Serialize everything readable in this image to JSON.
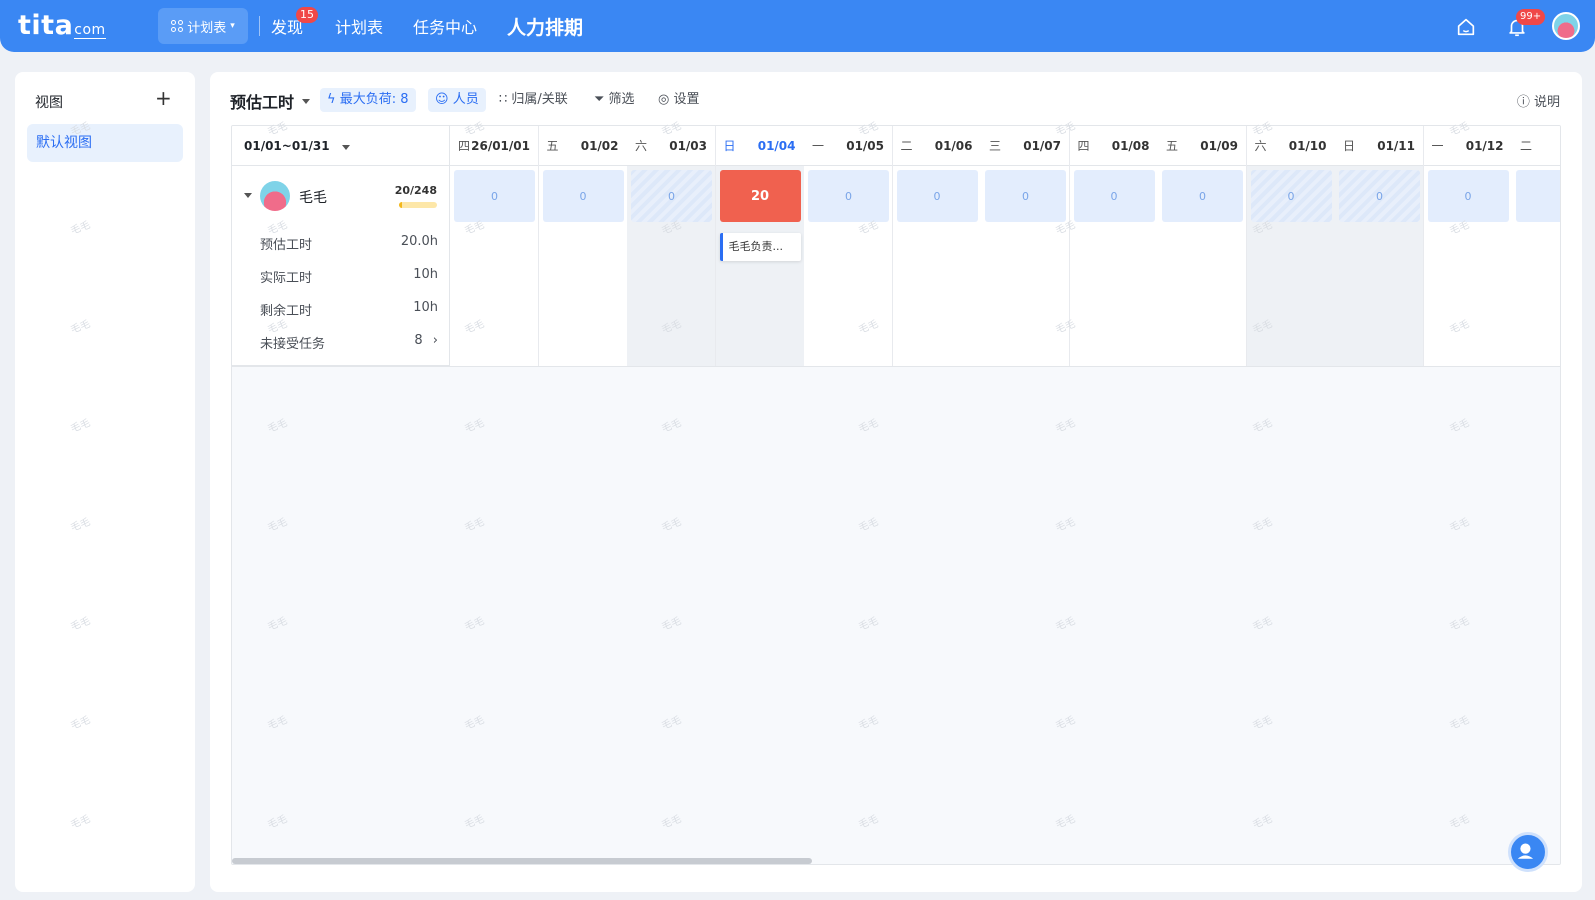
{
  "topbar": {
    "logo_text": "tita",
    "logo_domain": "com",
    "plan_switch_label": "计划表",
    "nav": [
      {
        "label": "发现",
        "badge": "15"
      },
      {
        "label": "计划表"
      },
      {
        "label": "任务中心"
      },
      {
        "label": "人力排期"
      }
    ],
    "bell_badge": "99+",
    "icons": [
      "home-icon",
      "bell-icon",
      "avatar"
    ]
  },
  "sidebar": {
    "title": "视图",
    "add_label": "+",
    "items": [
      {
        "label": "默认视图",
        "selected": true
      }
    ]
  },
  "toolbar": {
    "title": "预估工时",
    "max_load": "最大负荷: 8",
    "people": "人员",
    "relation": "归属/关联",
    "filter": "筛选",
    "settings": "设置",
    "help": "说明"
  },
  "grid": {
    "range_label": "01/01~01/31",
    "days": [
      {
        "w": "四",
        "d": "26/01/01",
        "load": "0",
        "type": "workday"
      },
      {
        "w": "五",
        "d": "01/02",
        "load": "0",
        "type": "workday"
      },
      {
        "w": "六",
        "d": "01/03",
        "load": "0",
        "type": "weekend"
      },
      {
        "w": "日",
        "d": "01/04",
        "load": "20",
        "type": "today-over"
      },
      {
        "w": "一",
        "d": "01/05",
        "load": "0",
        "type": "workday"
      },
      {
        "w": "二",
        "d": "01/06",
        "load": "0",
        "type": "workday"
      },
      {
        "w": "三",
        "d": "01/07",
        "load": "0",
        "type": "workday"
      },
      {
        "w": "四",
        "d": "01/08",
        "load": "0",
        "type": "workday"
      },
      {
        "w": "五",
        "d": "01/09",
        "load": "0",
        "type": "workday"
      },
      {
        "w": "六",
        "d": "01/10",
        "load": "0",
        "type": "weekend"
      },
      {
        "w": "日",
        "d": "01/11",
        "load": "0",
        "type": "weekend"
      },
      {
        "w": "一",
        "d": "01/12",
        "load": "0",
        "type": "workday"
      },
      {
        "w": "二",
        "d": "",
        "load": "",
        "type": "workday"
      }
    ],
    "person": {
      "name": "毛毛",
      "capacity": "20/248",
      "capacity_fraction": 0.08,
      "stats": [
        {
          "label": "预估工时",
          "value": "20.0h"
        },
        {
          "label": "实际工时",
          "value": "10h"
        },
        {
          "label": "剩余工时",
          "value": "10h"
        },
        {
          "label": "未接受任务",
          "value": "8"
        }
      ],
      "task_card": "毛毛负责..."
    },
    "watermark": "毛毛"
  }
}
